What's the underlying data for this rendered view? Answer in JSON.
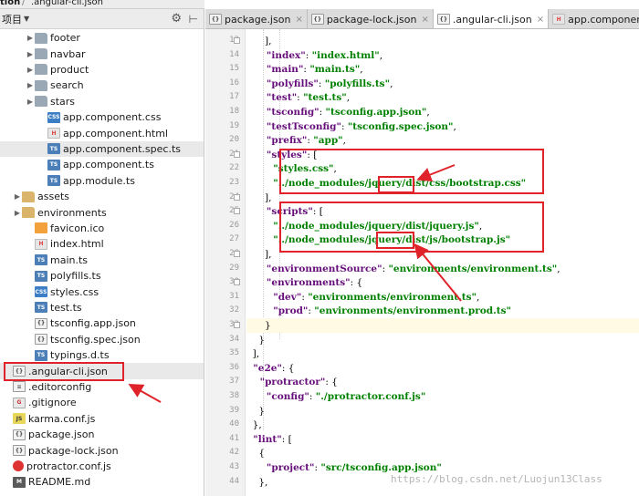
{
  "breadcrumb": {
    "project_fragment": "tion",
    "file": ".angular-cli.json"
  },
  "project_panel": {
    "title": "项目",
    "items": [
      {
        "label": "footer",
        "kind": "folder",
        "depth": 2,
        "expandable": true
      },
      {
        "label": "navbar",
        "kind": "folder",
        "depth": 2,
        "expandable": true
      },
      {
        "label": "product",
        "kind": "folder",
        "depth": 2,
        "expandable": true
      },
      {
        "label": "search",
        "kind": "folder",
        "depth": 2,
        "expandable": true
      },
      {
        "label": "stars",
        "kind": "folder",
        "depth": 2,
        "expandable": true
      },
      {
        "label": "app.component.css",
        "kind": "css",
        "depth": 3
      },
      {
        "label": "app.component.html",
        "kind": "html",
        "depth": 3
      },
      {
        "label": "app.component.spec.ts",
        "kind": "ts",
        "depth": 3,
        "highlighted": true
      },
      {
        "label": "app.component.ts",
        "kind": "ts",
        "depth": 3
      },
      {
        "label": "app.module.ts",
        "kind": "ts",
        "depth": 3
      },
      {
        "label": "assets",
        "kind": "folder",
        "depth": 1,
        "expandable": true
      },
      {
        "label": "environments",
        "kind": "folder",
        "depth": 1,
        "expandable": true
      },
      {
        "label": "favicon.ico",
        "kind": "ico",
        "depth": 2
      },
      {
        "label": "index.html",
        "kind": "html",
        "depth": 2
      },
      {
        "label": "main.ts",
        "kind": "ts",
        "depth": 2
      },
      {
        "label": "polyfills.ts",
        "kind": "ts",
        "depth": 2
      },
      {
        "label": "styles.css",
        "kind": "css",
        "depth": 2
      },
      {
        "label": "test.ts",
        "kind": "ts",
        "depth": 2
      },
      {
        "label": "tsconfig.app.json",
        "kind": "json",
        "depth": 2
      },
      {
        "label": "tsconfig.spec.json",
        "kind": "json",
        "depth": 2
      },
      {
        "label": "typings.d.ts",
        "kind": "ts",
        "depth": 2
      },
      {
        "label": ".angular-cli.json",
        "kind": "json",
        "depth": 0,
        "selected": true
      },
      {
        "label": ".editorconfig",
        "kind": "file",
        "depth": 0
      },
      {
        "label": ".gitignore",
        "kind": "git",
        "depth": 0
      },
      {
        "label": "karma.conf.js",
        "kind": "js",
        "depth": 0
      },
      {
        "label": "package.json",
        "kind": "json",
        "depth": 0
      },
      {
        "label": "package-lock.json",
        "kind": "json",
        "depth": 0
      },
      {
        "label": "protractor.conf.js",
        "kind": "proto",
        "depth": 0
      },
      {
        "label": "README.md",
        "kind": "md",
        "depth": 0
      }
    ]
  },
  "tabs": [
    {
      "label": "package.json",
      "active": false,
      "icon": "json-icon"
    },
    {
      "label": "package-lock.json",
      "active": false,
      "icon": "json-icon"
    },
    {
      "label": ".angular-cli.json",
      "active": true,
      "icon": "json-icon"
    },
    {
      "label": "app.component.html",
      "active": false,
      "icon": "html-icon"
    }
  ],
  "editor": {
    "lines": [
      {
        "n": "13",
        "tokens": [
          [
            "p",
            "      ],"
          ]
        ]
      },
      {
        "n": "14",
        "tokens": [
          [
            "k",
            "      \"index\""
          ],
          [
            "p",
            ": "
          ],
          [
            "s",
            "\"index.html\""
          ],
          [
            "p",
            ","
          ]
        ]
      },
      {
        "n": "15",
        "tokens": [
          [
            "k",
            "      \"main\""
          ],
          [
            "p",
            ": "
          ],
          [
            "s",
            "\"main.ts\""
          ],
          [
            "p",
            ","
          ]
        ]
      },
      {
        "n": "16",
        "tokens": [
          [
            "k",
            "      \"polyfills\""
          ],
          [
            "p",
            ": "
          ],
          [
            "s",
            "\"polyfills.ts\""
          ],
          [
            "p",
            ","
          ]
        ]
      },
      {
        "n": "17",
        "tokens": [
          [
            "k",
            "      \"test\""
          ],
          [
            "p",
            ": "
          ],
          [
            "s",
            "\"test.ts\""
          ],
          [
            "p",
            ","
          ]
        ]
      },
      {
        "n": "18",
        "tokens": [
          [
            "k",
            "      \"tsconfig\""
          ],
          [
            "p",
            ": "
          ],
          [
            "s",
            "\"tsconfig.app.json\""
          ],
          [
            "p",
            ","
          ]
        ]
      },
      {
        "n": "19",
        "tokens": [
          [
            "k",
            "      \"testTsconfig\""
          ],
          [
            "p",
            ": "
          ],
          [
            "s",
            "\"tsconfig.spec.json\""
          ],
          [
            "p",
            ","
          ]
        ]
      },
      {
        "n": "20",
        "tokens": [
          [
            "k",
            "      \"prefix\""
          ],
          [
            "p",
            ": "
          ],
          [
            "s",
            "\"app\""
          ],
          [
            "p",
            ","
          ]
        ]
      },
      {
        "n": "21",
        "tokens": [
          [
            "k",
            "      \"styles\""
          ],
          [
            "p",
            ": ["
          ]
        ]
      },
      {
        "n": "22",
        "tokens": [
          [
            "s",
            "        \"styles.css\""
          ],
          [
            "p",
            ","
          ]
        ]
      },
      {
        "n": "23",
        "tokens": [
          [
            "s",
            "        \"../node_modules/jquery/dist/css/bootstrap.css\""
          ]
        ]
      },
      {
        "n": "24",
        "tokens": [
          [
            "p",
            "      ],"
          ]
        ]
      },
      {
        "n": "25",
        "tokens": [
          [
            "k",
            "      \"scripts\""
          ],
          [
            "p",
            ": ["
          ]
        ]
      },
      {
        "n": "26",
        "tokens": [
          [
            "s",
            "        \"../node_modules/jquery/dist/jquery.js\""
          ],
          [
            "p",
            ","
          ]
        ]
      },
      {
        "n": "27",
        "tokens": [
          [
            "s",
            "        \"../node_modules/jquery/dist/js/bootstrap.js\""
          ]
        ]
      },
      {
        "n": "28",
        "tokens": [
          [
            "p",
            "      ],"
          ]
        ]
      },
      {
        "n": "29",
        "tokens": [
          [
            "k",
            "      \"environmentSource\""
          ],
          [
            "p",
            ": "
          ],
          [
            "s",
            "\"environments/environment.ts\""
          ],
          [
            "p",
            ","
          ]
        ]
      },
      {
        "n": "30",
        "tokens": [
          [
            "k",
            "      \"environments\""
          ],
          [
            "p",
            ": {"
          ]
        ]
      },
      {
        "n": "31",
        "tokens": [
          [
            "k",
            "        \"dev\""
          ],
          [
            "p",
            ": "
          ],
          [
            "s",
            "\"environments/environment.ts\""
          ],
          [
            "p",
            ","
          ]
        ]
      },
      {
        "n": "32",
        "tokens": [
          [
            "k",
            "        \"prod\""
          ],
          [
            "p",
            ": "
          ],
          [
            "s",
            "\"environments/environment.prod.ts\""
          ]
        ]
      },
      {
        "n": "33",
        "tokens": [
          [
            "p",
            "      }"
          ]
        ],
        "caret": true
      },
      {
        "n": "34",
        "tokens": [
          [
            "p",
            "    }"
          ]
        ]
      },
      {
        "n": "35",
        "tokens": [
          [
            "p",
            "  ],"
          ]
        ]
      },
      {
        "n": "36",
        "tokens": [
          [
            "k",
            "  \"e2e\""
          ],
          [
            "p",
            ": {"
          ]
        ]
      },
      {
        "n": "37",
        "tokens": [
          [
            "k",
            "    \"protractor\""
          ],
          [
            "p",
            ": {"
          ]
        ]
      },
      {
        "n": "38",
        "tokens": [
          [
            "k",
            "      \"config\""
          ],
          [
            "p",
            ": "
          ],
          [
            "s",
            "\"./protractor.conf.js\""
          ]
        ]
      },
      {
        "n": "39",
        "tokens": [
          [
            "p",
            "    }"
          ]
        ]
      },
      {
        "n": "40",
        "tokens": [
          [
            "p",
            "  },"
          ]
        ]
      },
      {
        "n": "41",
        "tokens": [
          [
            "k",
            "  \"lint\""
          ],
          [
            "p",
            ": ["
          ]
        ]
      },
      {
        "n": "42",
        "tokens": [
          [
            "p",
            "    {"
          ]
        ]
      },
      {
        "n": "43",
        "tokens": [
          [
            "k",
            "      \"project\""
          ],
          [
            "p",
            ": "
          ],
          [
            "s",
            "\"src/tsconfig.app.json\""
          ]
        ]
      },
      {
        "n": "44",
        "tokens": [
          [
            "p",
            "    },"
          ]
        ]
      }
    ]
  },
  "annotation_color": "#e0232b",
  "watermark": "https://blog.csdn.net/Luojun13Class"
}
